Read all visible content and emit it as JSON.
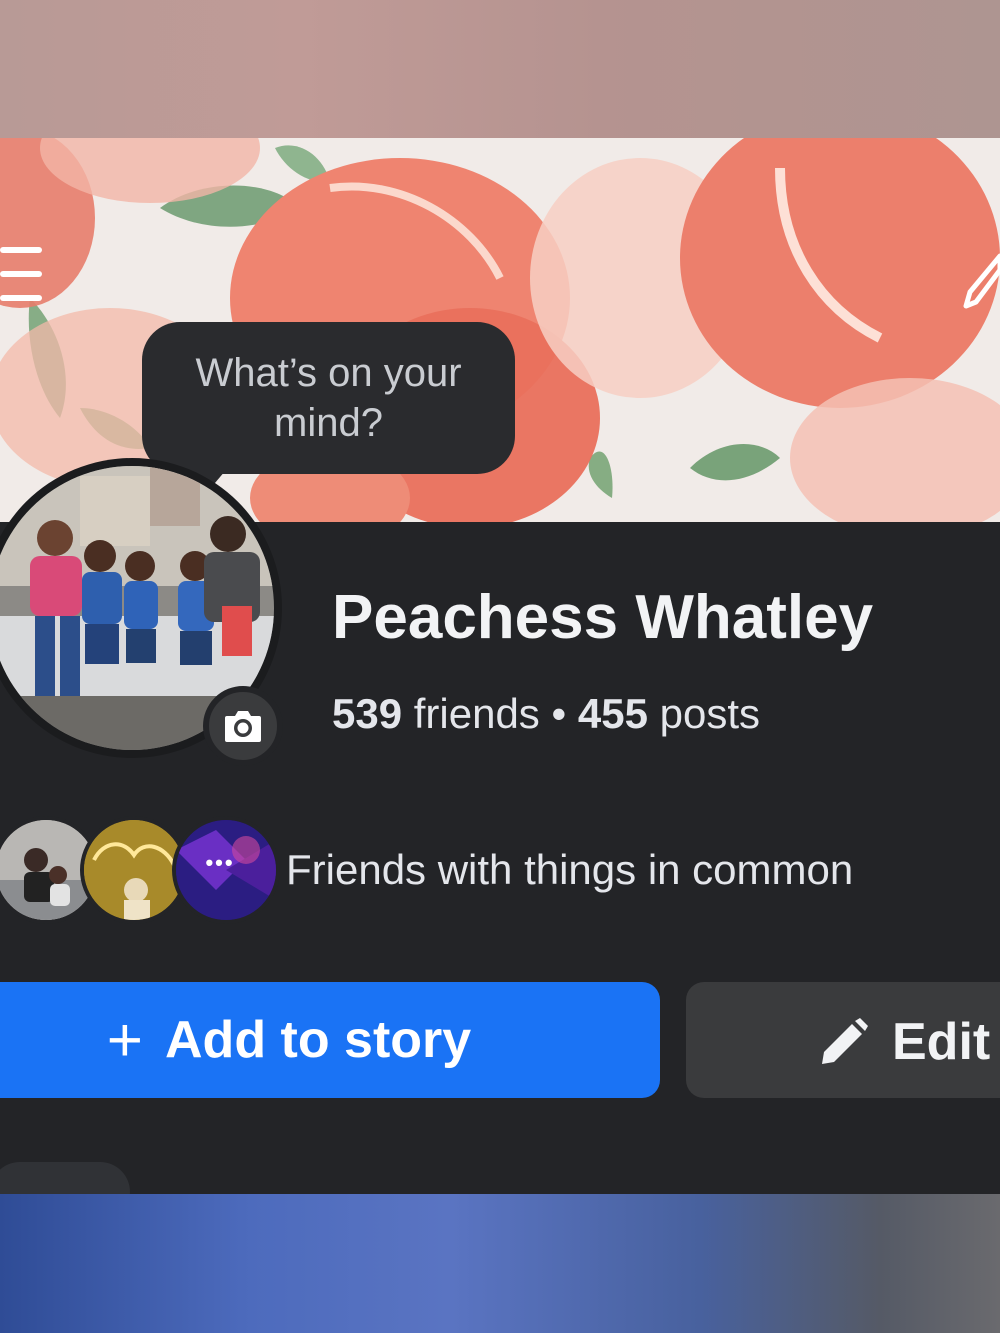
{
  "header": {
    "menu_icon": "hamburger-menu-icon",
    "edit_cover_icon": "pencil-icon"
  },
  "composer_bubble": {
    "line1": "What’s on your",
    "line2": "mind?"
  },
  "profile": {
    "name": "Peachess Whatley",
    "friends_count": "539",
    "friends_label": " friends",
    "separator": " • ",
    "posts_count": "455",
    "posts_label": " posts",
    "camera_icon": "camera-icon"
  },
  "mutual_friends": {
    "more_glyph": "•••",
    "text": "Friends with things in common"
  },
  "actions": {
    "add_story_plus": "+",
    "add_story_label": "Add to story",
    "edit_label": "Edit"
  },
  "colors": {
    "panel": "#232427",
    "primary_button": "#1a73f5",
    "secondary_button": "#3a3b3d",
    "text_primary": "#f2f3f5"
  }
}
